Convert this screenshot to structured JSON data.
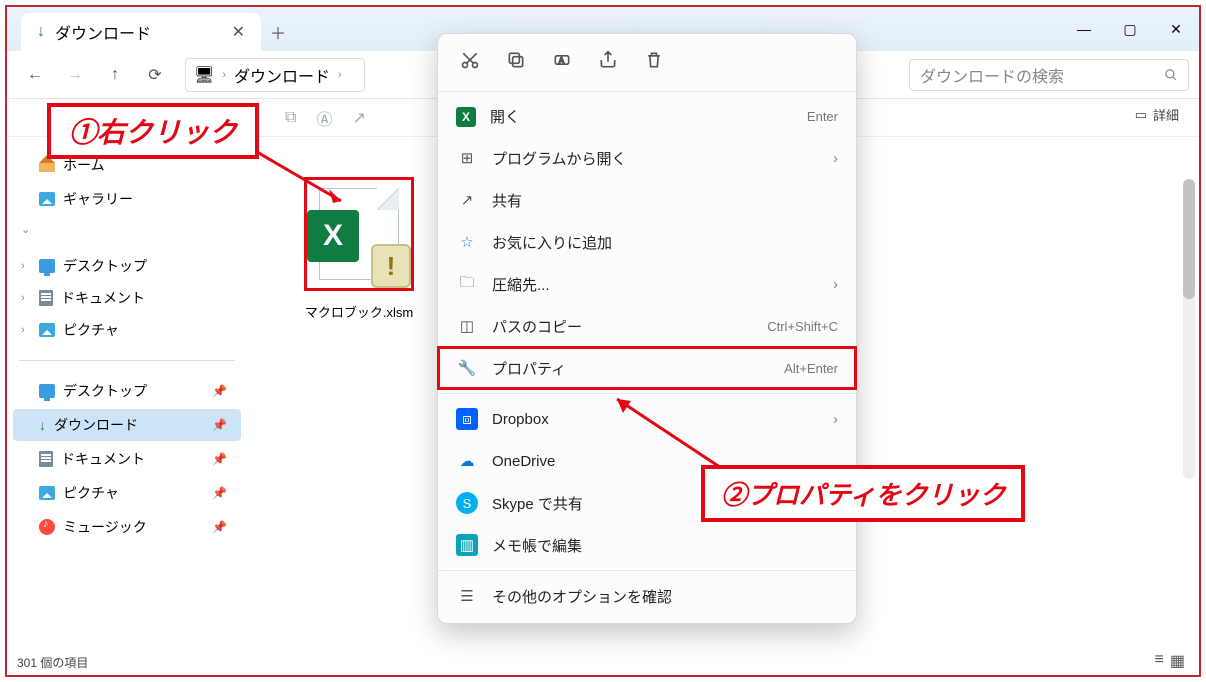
{
  "tab": {
    "title": "ダウンロード"
  },
  "breadcrumb": {
    "item": "ダウンロード"
  },
  "search": {
    "placeholder": "ダウンロードの検索"
  },
  "details_button": "詳細",
  "nav": {
    "home": "ホーム",
    "gallery": "ギャラリー",
    "desktop": "デスクトップ",
    "documents": "ドキュメント",
    "pictures": "ピクチャ",
    "q_desktop": "デスクトップ",
    "q_downloads": "ダウンロード",
    "q_documents": "ドキュメント",
    "q_pictures": "ピクチャ",
    "q_music": "ミュージック"
  },
  "file": {
    "name": "マクロブック.xlsm"
  },
  "status": "301 個の項目",
  "ctx": {
    "open": "開く",
    "open_sc": "Enter",
    "openwith": "プログラムから開く",
    "share": "共有",
    "fav": "お気に入りに追加",
    "compress": "圧縮先...",
    "copypath": "パスのコピー",
    "copypath_sc": "Ctrl+Shift+C",
    "properties": "プロパティ",
    "properties_sc": "Alt+Enter",
    "dropbox": "Dropbox",
    "onedrive": "OneDrive",
    "skype": "Skype で共有",
    "notepad": "メモ帳で編集",
    "more": "その他のオプションを確認"
  },
  "annotation1": "①右クリック",
  "annotation2": "②プロパティをクリック"
}
